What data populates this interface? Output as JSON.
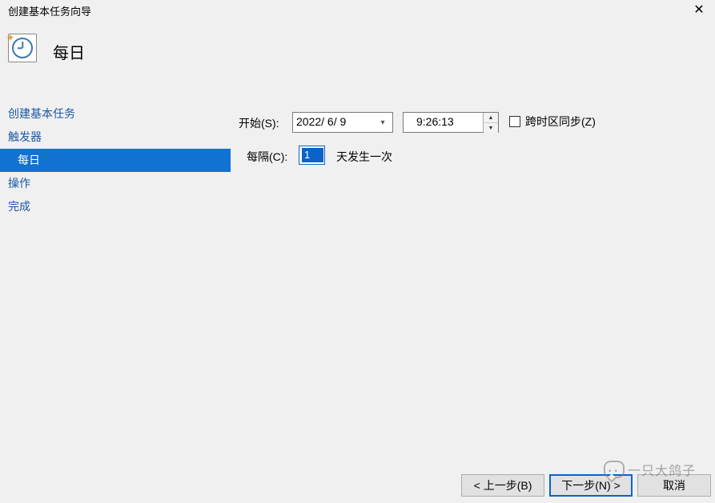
{
  "titlebar": {
    "title": "创建基本任务向导"
  },
  "header": {
    "heading": "每日"
  },
  "nav": {
    "items": [
      {
        "label": "创建基本任务",
        "level": 1,
        "selected": false
      },
      {
        "label": "触发器",
        "level": 1,
        "selected": false
      },
      {
        "label": "每日",
        "level": 2,
        "selected": true
      },
      {
        "label": "操作",
        "level": 1,
        "selected": false
      },
      {
        "label": "完成",
        "level": 1,
        "selected": false
      }
    ]
  },
  "form": {
    "start_label": "开始(S):",
    "date_value": "2022/ 6/ 9",
    "time_value": "9:26:13",
    "tz_sync_label": "跨时区同步(Z)",
    "tz_sync_checked": false,
    "interval_label": "每隔(C):",
    "interval_value": "1",
    "interval_suffix": "天发生一次"
  },
  "footer": {
    "back": "< 上一步(B)",
    "next": "下一步(N) >",
    "cancel": "取消"
  },
  "watermark": "一只大鸽子"
}
